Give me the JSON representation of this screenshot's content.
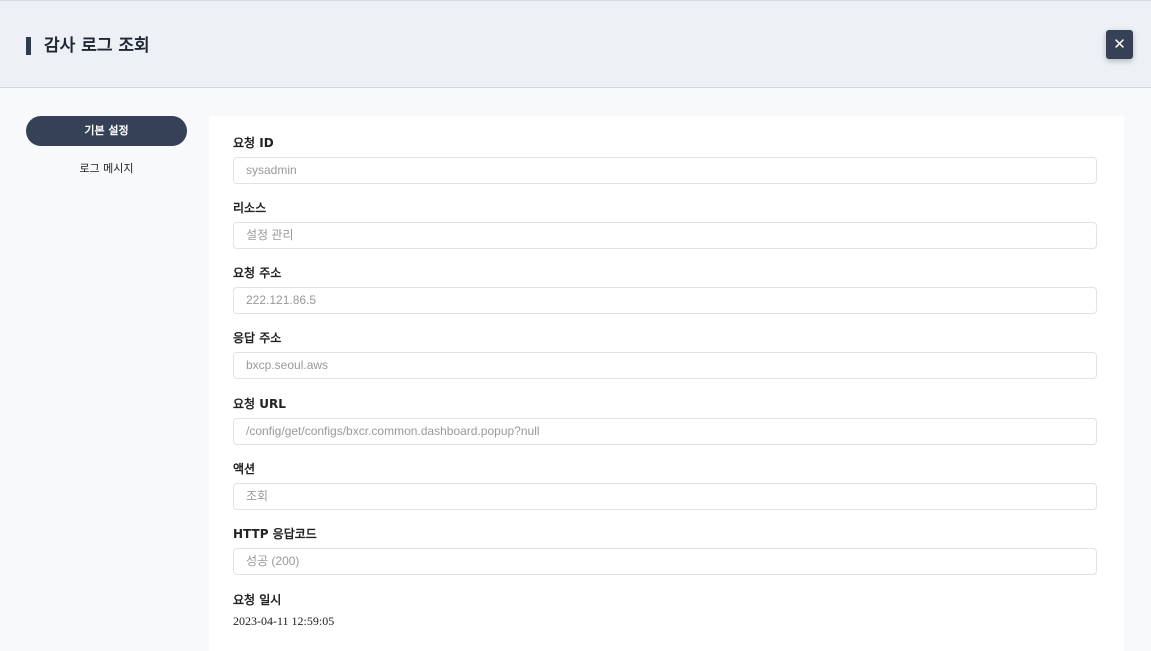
{
  "header": {
    "title": "감사 로그 조회",
    "close_symbol": "✕"
  },
  "sidebar": {
    "items": [
      {
        "label": "기본 설정",
        "active": true
      },
      {
        "label": "로그 메시지",
        "active": false
      }
    ]
  },
  "form": {
    "fields": [
      {
        "label": "요청 ID",
        "value": "sysadmin"
      },
      {
        "label": "리소스",
        "value": "설정 관리"
      },
      {
        "label": "요청 주소",
        "value": "222.121.86.5"
      },
      {
        "label": "응답 주소",
        "value": "bxcp.seoul.aws"
      },
      {
        "label": "요청 URL",
        "value": "/config/get/configs/bxcr.common.dashboard.popup?null"
      },
      {
        "label": "액션",
        "value": "조회"
      },
      {
        "label": "HTTP 응답코드",
        "value": "성공 (200)"
      },
      {
        "label": "요청 일시",
        "value": "2023-04-11 12:59:05"
      }
    ]
  },
  "colors": {
    "accent": "#364157",
    "header_bg": "#edf1f6"
  }
}
